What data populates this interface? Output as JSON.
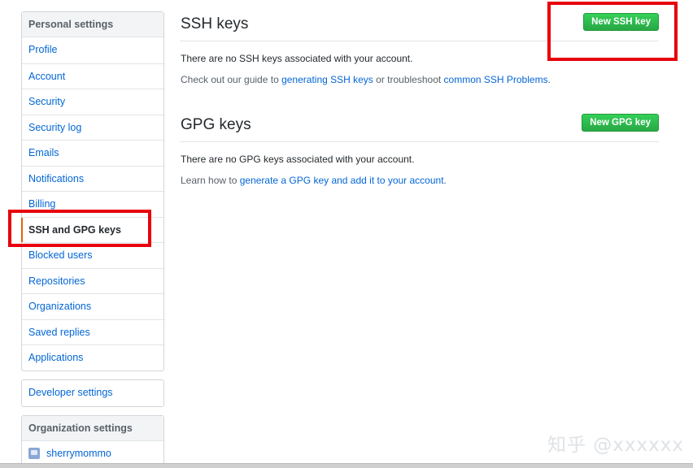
{
  "sidebar": {
    "personal_heading": "Personal settings",
    "items": [
      {
        "label": "Profile"
      },
      {
        "label": "Account"
      },
      {
        "label": "Security"
      },
      {
        "label": "Security log"
      },
      {
        "label": "Emails"
      },
      {
        "label": "Notifications"
      },
      {
        "label": "Billing"
      },
      {
        "label": "SSH and GPG keys",
        "selected": true
      },
      {
        "label": "Blocked users"
      },
      {
        "label": "Repositories"
      },
      {
        "label": "Organizations"
      },
      {
        "label": "Saved replies"
      },
      {
        "label": "Applications"
      }
    ],
    "developer_settings": "Developer settings",
    "org_heading": "Organization settings",
    "org_items": [
      {
        "label": "sherrymommo",
        "icon": "org-avatar-icon"
      }
    ]
  },
  "ssh": {
    "title": "SSH keys",
    "new_button": "New SSH key",
    "empty_text": "There are no SSH keys associated with your account.",
    "guide_prefix": "Check out our guide to ",
    "guide_link": "generating SSH keys",
    "guide_middle": " or troubleshoot ",
    "problems_link": "common SSH Problems",
    "guide_suffix": "."
  },
  "gpg": {
    "title": "GPG keys",
    "new_button": "New GPG key",
    "empty_text": "There are no GPG keys associated with your account.",
    "learn_prefix": "Learn how to ",
    "learn_link": "generate a GPG key and add it to your account",
    "learn_suffix": "."
  },
  "watermark": "知乎 @xxxxxx",
  "colors": {
    "link": "#0366d6",
    "button_green": "#28a745",
    "selected_accent": "#e36209",
    "highlight_red": "#e8000b"
  }
}
